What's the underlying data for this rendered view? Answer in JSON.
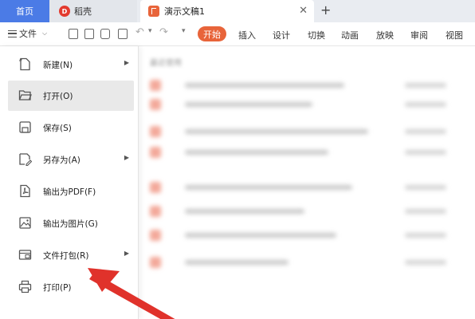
{
  "tabs": {
    "home": "首页",
    "daoke": "稻壳",
    "daoke_logo": "D",
    "document": "演示文稿1",
    "close": "✕",
    "add": "+"
  },
  "toolbar": {
    "file_label": "文件",
    "ribbon": [
      "开始",
      "插入",
      "设计",
      "切换",
      "动画",
      "放映",
      "审阅",
      "视图"
    ],
    "accent_color": "#e8643a"
  },
  "file_menu": {
    "items": [
      {
        "label": "新建(N)",
        "icon": "new-file-icon",
        "has_submenu": true,
        "active": false
      },
      {
        "label": "打开(O)",
        "icon": "folder-open-icon",
        "has_submenu": false,
        "active": true
      },
      {
        "label": "保存(S)",
        "icon": "save-icon",
        "has_submenu": false,
        "active": false
      },
      {
        "label": "另存为(A)",
        "icon": "save-as-icon",
        "has_submenu": true,
        "active": false
      },
      {
        "label": "输出为PDF(F)",
        "icon": "pdf-export-icon",
        "has_submenu": false,
        "active": false
      },
      {
        "label": "输出为图片(G)",
        "icon": "image-export-icon",
        "has_submenu": false,
        "active": false
      },
      {
        "label": "文件打包(R)",
        "icon": "package-icon",
        "has_submenu": true,
        "active": false
      },
      {
        "label": "打印(P)",
        "icon": "print-icon",
        "has_submenu": false,
        "active": false
      }
    ]
  },
  "recent": {
    "heading": "最近使用"
  },
  "annotation": {
    "arrow_color": "#e0322b",
    "points_to": "文件打包(R)"
  }
}
